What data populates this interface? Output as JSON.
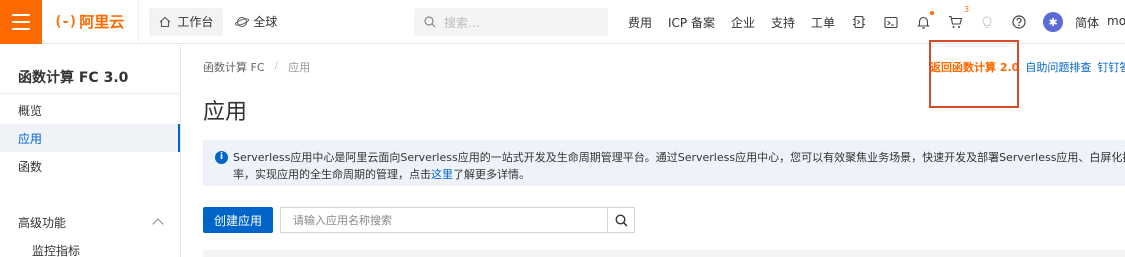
{
  "topbar": {
    "logo_mark": "(-)",
    "logo_text": "阿里云",
    "workspace_label": "工作台",
    "region_label": "全球",
    "search_placeholder": "搜索...",
    "links": [
      "费用",
      "ICP 备案",
      "企业",
      "支持",
      "工单"
    ],
    "cart_count": "3",
    "lang": "简体",
    "user": "mo"
  },
  "sidebar": {
    "title": "函数计算 FC 3.0",
    "items": [
      {
        "label": "概览"
      },
      {
        "label": "应用"
      },
      {
        "label": "函数"
      }
    ],
    "group_label": "高级功能",
    "sub_item": "监控指标"
  },
  "main": {
    "breadcrumb": [
      "函数计算 FC",
      "应用"
    ],
    "title": "应用",
    "actions": {
      "back_v2": "返回函数计算 2.0",
      "troubleshoot": "自助问题排查",
      "dingtalk": "钉钉答"
    },
    "info": {
      "line1": "Serverless应用中心是阿里云面向Serverless应用的一站式开发及生命周期管理平台。通过Serverless应用中心，您可以有效聚焦业务场景，快速开发及部署Serverless应用、白屏化操作资源",
      "line2_pre": "率，实现应用的全生命周期的管理，点击",
      "link": "这里",
      "line2_post": "了解更多详情。"
    },
    "create_button": "创建应用",
    "app_search_placeholder": "请输入应用名称搜索"
  },
  "colors": {
    "brand": "#ff6a00",
    "primary": "#0064c8",
    "highlight_box": "#d94a2b"
  }
}
